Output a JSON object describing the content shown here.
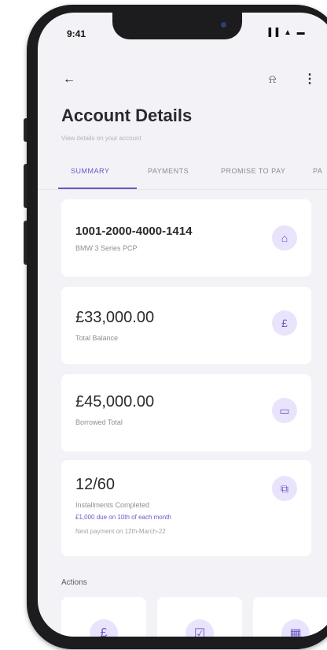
{
  "status_bar": {
    "time": "9:41",
    "icons": "▐▐ ▲ ▬"
  },
  "header": {
    "back_icon": "←",
    "bell_icon": "⍾",
    "more_icon": "⋮"
  },
  "page": {
    "title": "Account Details",
    "subtitle": "View details on your account"
  },
  "tabs": [
    {
      "label": "SUMMARY"
    },
    {
      "label": "PAYMENTS"
    },
    {
      "label": "PROMISE TO PAY"
    },
    {
      "label": "PA"
    }
  ],
  "cards": {
    "account": {
      "number": "1001-2000-4000-1414",
      "product": "BMW 3 Series PCP",
      "icon": "⌂"
    },
    "total_balance": {
      "amount": "£33,000.00",
      "label": "Total Balance",
      "icon": "£"
    },
    "borrowed": {
      "amount": "£45,000.00",
      "label": "Borrowed Total",
      "icon": "▭"
    },
    "installments": {
      "value": "12/60",
      "label": "Installments Completed",
      "due": "£1,000 due on 10th of each month",
      "next": "Next payment on 12th-March-22",
      "icon": "⧉"
    }
  },
  "actions": {
    "label": "Actions",
    "items": [
      {
        "icon": "£"
      },
      {
        "icon": "☑"
      },
      {
        "icon": "▦"
      }
    ]
  },
  "colors": {
    "accent": "#6d57c9",
    "icon_bg": "#e9e4fb",
    "background": "#f3f3f7"
  }
}
